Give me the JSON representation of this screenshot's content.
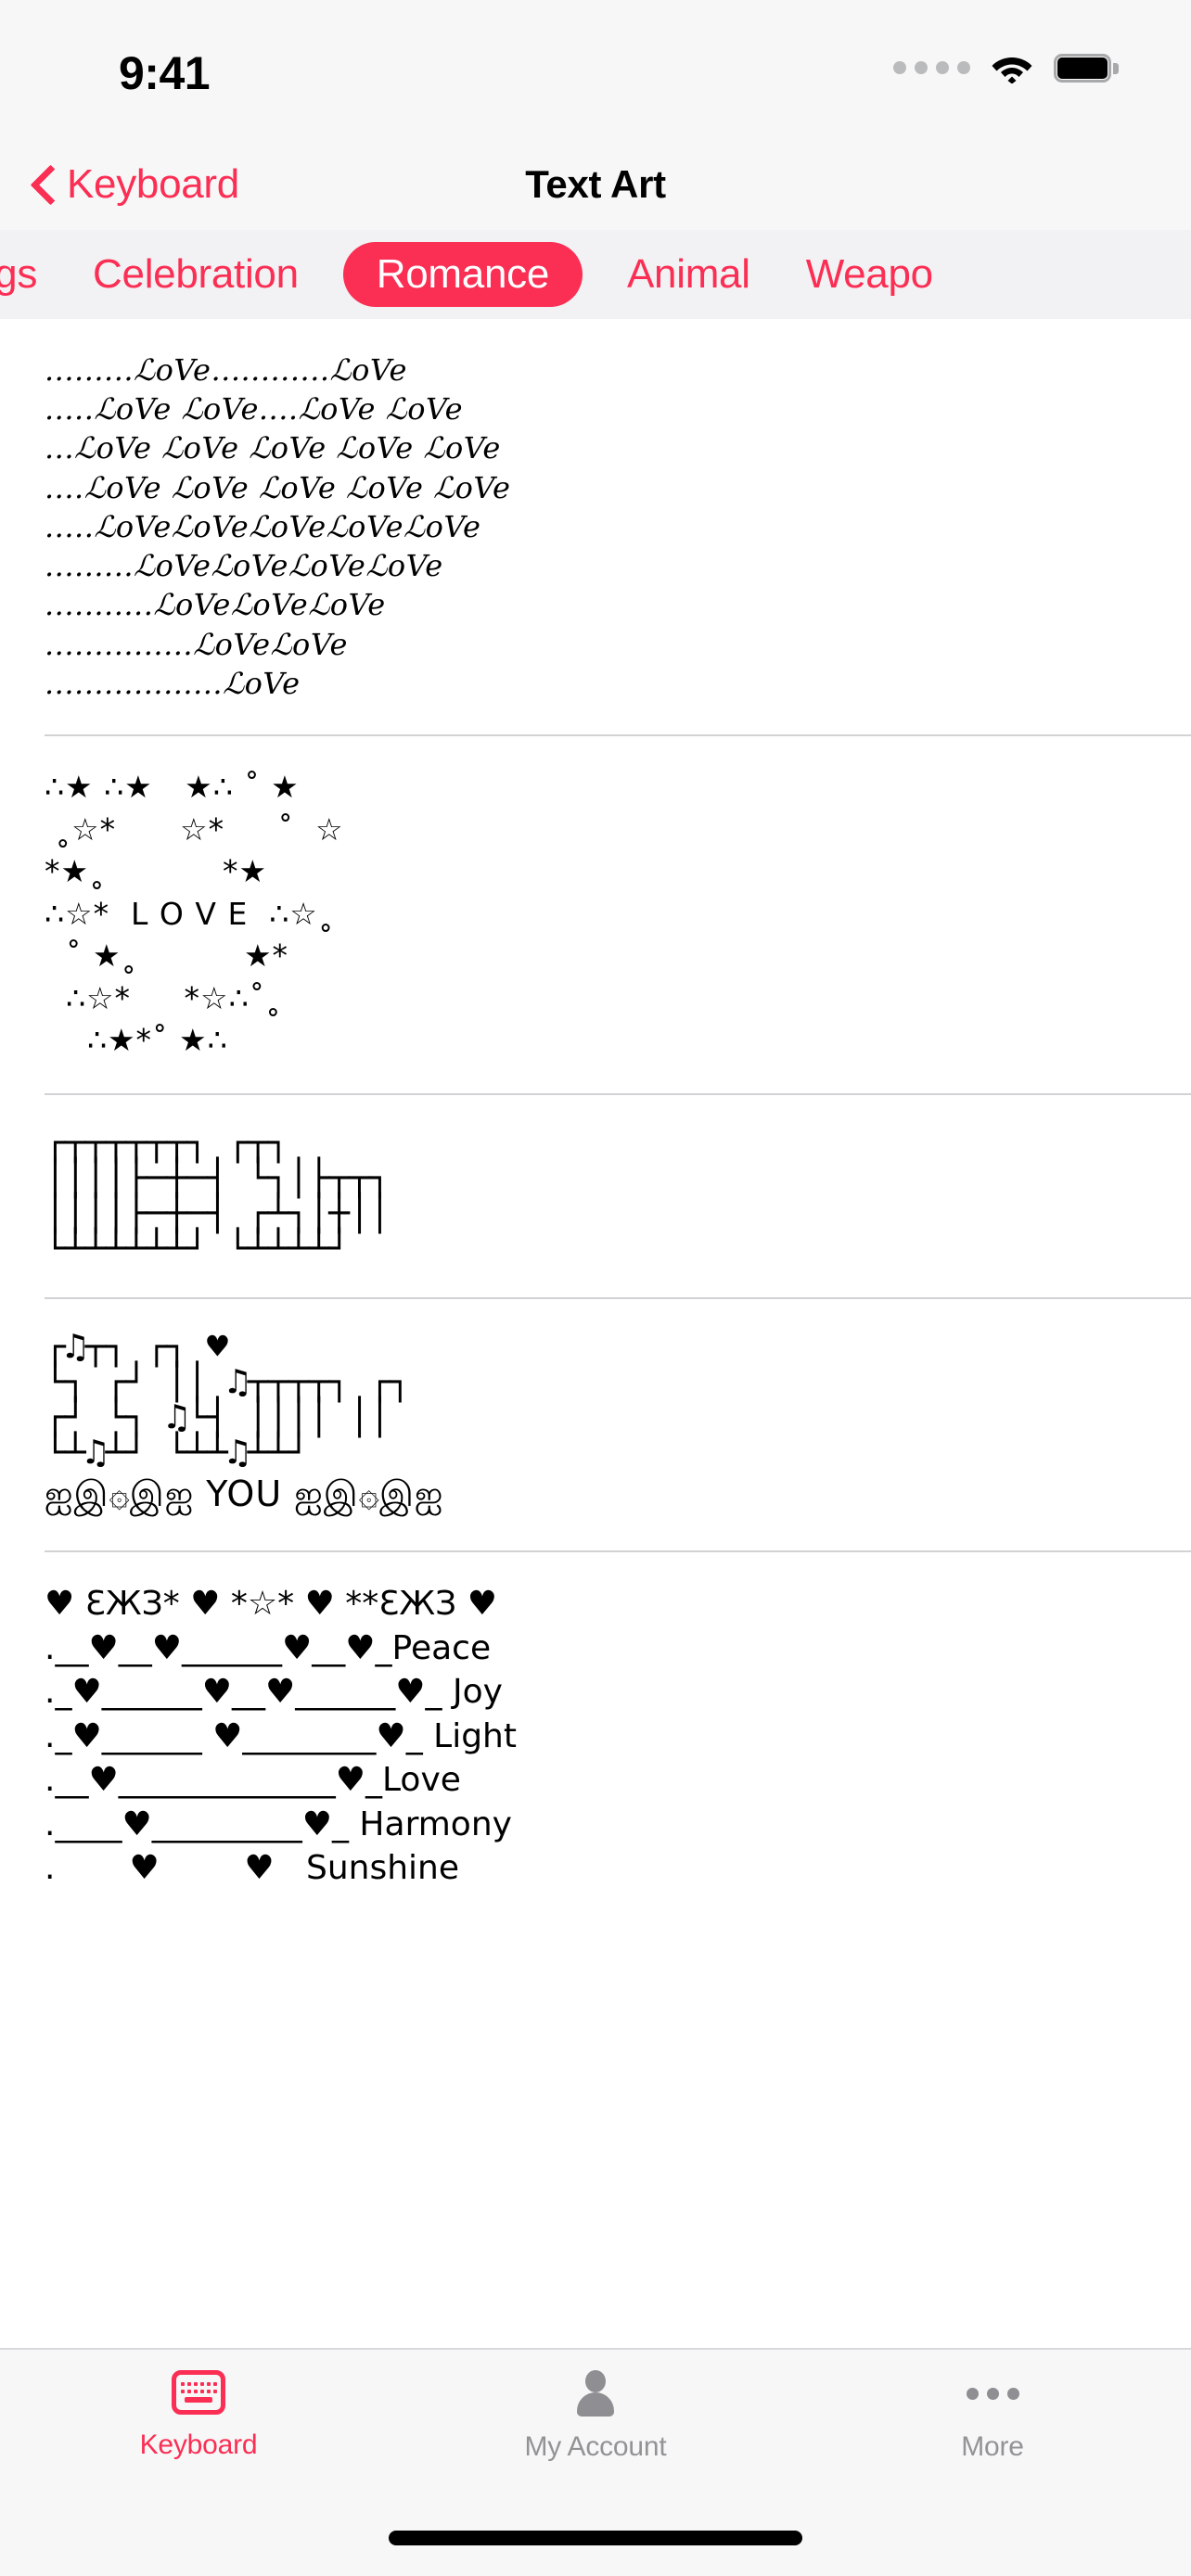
{
  "status_bar": {
    "time": "9:41",
    "signal_icon": "signal-dots-icon",
    "wifi_icon": "wifi-icon",
    "battery_icon": "battery-full-icon"
  },
  "nav_bar": {
    "back_icon": "chevron-left-icon",
    "back_label": "Keyboard",
    "title": "Text Art"
  },
  "categories": {
    "items": [
      {
        "label": "ngs",
        "active": false,
        "clipped": true
      },
      {
        "label": "Celebration",
        "active": false,
        "clipped": false
      },
      {
        "label": "Romance",
        "active": true,
        "clipped": false
      },
      {
        "label": "Animal",
        "active": false,
        "clipped": false
      },
      {
        "label": "Weapo",
        "active": false,
        "clipped": false
      }
    ]
  },
  "art_items": [
    {
      "name": "love-word-heart",
      "style": "script",
      "text": ".........ℒoVe............ℒoVe\n.....ℒoVe ℒoVe....ℒoVe ℒoVe\n...ℒoVe ℒoVe ℒoVe ℒoVe ℒoVe\n....ℒoVe ℒoVe ℒoVe ℒoVe ℒoVe\n.....ℒoVeℒoVeℒoVeℒoVeℒoVe\n.........ℒoVeℒoVeℒoVeℒoVe\n...........ℒoVeℒoVeℒoVe\n...............ℒoVeℒoVe\n..................ℒoVe"
    },
    {
      "name": "star-heart-love",
      "style": "stars",
      "text": "∴★ ∴★   ★∴ ˚ ★\n ˳☆*      ☆*     ˚  ☆\n*★˳           *★\n∴☆*  L O V E  ∴☆˳\n  ˚ ★˳          ★*\n  ∴☆*     *☆∴˚˳\n    ∴★*˚ ★∴"
    },
    {
      "name": "miss-you-box-art",
      "style": "box",
      "text": "┌┬┬┬┬┬┬┐ ┌┬┐\n││││├─┼─┤ └┐│├┬┬┐\n││││├─┼─┤ ┌┴┐│┼││\n└┴┴┴┴┴┴┘ └┴┴┴┴┘"
    },
    {
      "name": "i-love-you-music-art",
      "style": "box",
      "text": "┌♫┬┐ ┌┐ ♥\n└┐ ┌┘ ││ ♫┬┬┬┬┐ ┌┐\n┌┘ └┐ ♫└┤ ││││ ││\n└┴♫┴┘ └┴┴♫┴┴┘"
    },
    {
      "name": "ornament-you-line",
      "style": "ornament",
      "text": "ஐஇ۞இஐ YOU ஐஇ۞இஐ"
    },
    {
      "name": "hearts-peace-list",
      "style": "hearts",
      "text": "♥ ƐЖЗ* ♥ *☆* ♥ **ƐЖЗ ♥\n.__♥__♥______♥__♥_Peace\n._♥______♥__♥______♥_ Joy\n._♥______ ♥________♥_ Light\n.__♥_____________♥_Love\n.____♥_________♥_ Harmony\n.       ♥        ♥   Sunshine"
    }
  ],
  "tab_bar": {
    "tabs": [
      {
        "label": "Keyboard",
        "icon": "keyboard-icon",
        "active": true
      },
      {
        "label": "My Account",
        "icon": "person-icon",
        "active": false
      },
      {
        "label": "More",
        "icon": "ellipsis-icon",
        "active": false
      }
    ]
  },
  "colors": {
    "accent": "#fb2e54",
    "inactive": "#8e8e93",
    "bar_bg": "#f7f7f7",
    "tabs_bg": "#f2f2f4"
  }
}
